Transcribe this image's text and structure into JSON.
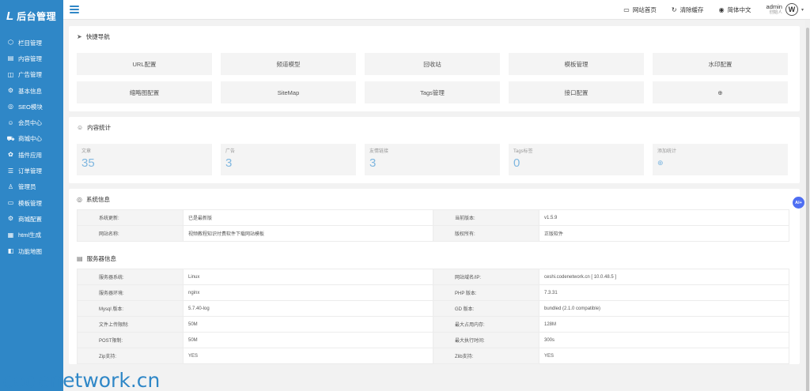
{
  "app": {
    "logo_mark": "L",
    "logo_text": "后台管理"
  },
  "sidebar": {
    "items": [
      {
        "icon": "⬡",
        "label": "栏目管理"
      },
      {
        "icon": "▤",
        "label": "内容管理"
      },
      {
        "icon": "◫",
        "label": "广告管理"
      },
      {
        "icon": "⚙",
        "label": "基本信息"
      },
      {
        "icon": "◎",
        "label": "SEO模块"
      },
      {
        "icon": "☺",
        "label": "会员中心"
      },
      {
        "icon": "⛟",
        "label": "商城中心"
      },
      {
        "icon": "✿",
        "label": "插件应用"
      },
      {
        "icon": "☰",
        "label": "订单管理"
      },
      {
        "icon": "♙",
        "label": "管理员"
      },
      {
        "icon": "▭",
        "label": "模板管理"
      },
      {
        "icon": "⚙",
        "label": "商城配置"
      },
      {
        "icon": "▦",
        "label": "html生成"
      },
      {
        "icon": "◧",
        "label": "功能地图"
      }
    ]
  },
  "topbar": {
    "links": [
      {
        "icon": "▭",
        "label": "网站首页"
      },
      {
        "icon": "↻",
        "label": "清除缓存"
      },
      {
        "icon": "◉",
        "label": "简体中文"
      }
    ],
    "user_name": "admin",
    "user_role": "创始人",
    "avatar": "W"
  },
  "quick_nav": {
    "icon": "➤",
    "title": "快捷导航",
    "items": [
      "URL配置",
      "频道模型",
      "回收站",
      "模板管理",
      "水印配置",
      "缩略图配置",
      "SiteMap",
      "Tags管理",
      "接口配置"
    ],
    "add_icon": "⊕"
  },
  "content_stats": {
    "icon": "☺",
    "title": "内容统计",
    "items": [
      {
        "label": "文章",
        "value": "35"
      },
      {
        "label": "广告",
        "value": "3"
      },
      {
        "label": "友情链接",
        "value": "3"
      },
      {
        "label": "Tags标签",
        "value": "0"
      }
    ],
    "add_label": "添加统计",
    "add_icon": "⊕"
  },
  "system_info": {
    "icon": "◎",
    "title": "系统信息",
    "rows": [
      [
        "系统更新:",
        "已是最新版",
        "当前版本:",
        "v1.5.9"
      ],
      [
        "网站名称:",
        "视频教程知识付费软件下载网站模板",
        "版权所有:",
        "正版软件"
      ]
    ]
  },
  "server_info": {
    "icon": "▤",
    "title": "服务器信息",
    "rows": [
      [
        "服务器系统:",
        "Linux",
        "网站域名/IP:",
        "ceshi.codenetwork.cn [ 10.0.48.5 ]"
      ],
      [
        "服务器环境:",
        "nginx",
        "PHP 版本:",
        "7.3.31"
      ],
      [
        "Mysql 版本:",
        "5.7.40-log",
        "GD 版本:",
        "bundled (2.1.0 compatible)"
      ],
      [
        "文件上传限制:",
        "50M",
        "最大占用内存:",
        "128M"
      ],
      [
        "POST限制:",
        "50M",
        "最大执行时间:",
        "300s"
      ],
      [
        "Zip支持:",
        "YES",
        "Zlib支持:",
        "YES"
      ]
    ]
  },
  "ai_button": "AI+",
  "watermark": "codenetwork.cn"
}
